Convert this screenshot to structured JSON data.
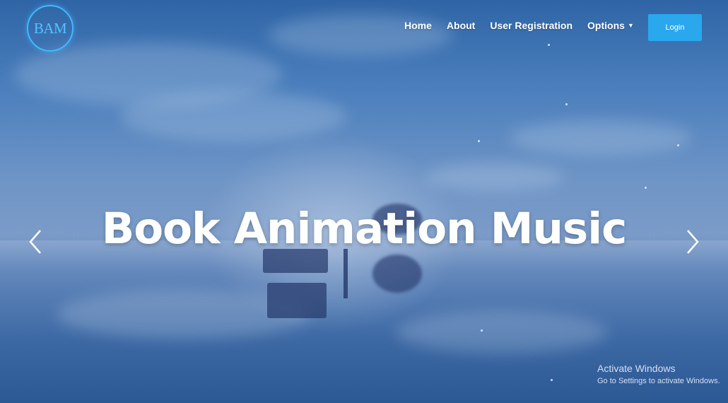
{
  "brand": {
    "logo_text": "BAM",
    "accent_color": "#3fb8ff"
  },
  "nav": {
    "items": [
      {
        "label": "Home"
      },
      {
        "label": "About"
      },
      {
        "label": "User Registration"
      },
      {
        "label": "Options",
        "has_dropdown": true
      }
    ],
    "login_label": "Login",
    "login_color": "#29a8ee"
  },
  "hero": {
    "title": "Book Animation Music",
    "prev_icon": "chevron-left-icon",
    "next_icon": "chevron-right-icon"
  },
  "watermark": {
    "title": "Activate Windows",
    "subtitle": "Go to Settings to activate Windows."
  }
}
